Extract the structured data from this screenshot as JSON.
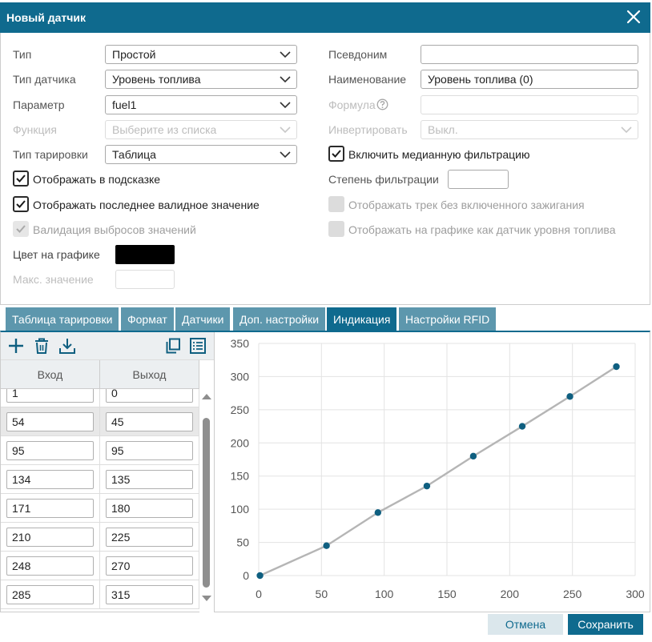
{
  "dialog": {
    "title": "Новый датчик"
  },
  "form": {
    "type": {
      "label": "Тип",
      "value": "Простой"
    },
    "sensor_type": {
      "label": "Тип датчика",
      "value": "Уровень топлива"
    },
    "parameter": {
      "label": "Параметр",
      "value": "fuel1"
    },
    "function": {
      "label": "Функция",
      "placeholder": "Выберите из списка"
    },
    "calibration_type": {
      "label": "Тип тарировки",
      "value": "Таблица"
    },
    "alias": {
      "label": "Псевдоним",
      "value": ""
    },
    "name": {
      "label": "Наименование",
      "value": "Уровень топлива (0)"
    },
    "formula": {
      "label": "Формула",
      "value": ""
    },
    "invert": {
      "label": "Инвертировать",
      "value": "Выкл."
    },
    "median_filter": {
      "label": "Включить медианную фильтрацию",
      "checked": true
    },
    "filter_degree": {
      "label": "Степень фильтрации",
      "value": ""
    },
    "show_tooltip": {
      "label": "Отображать в подсказке",
      "checked": true
    },
    "show_last_valid": {
      "label": "Отображать последнее валидное значение",
      "checked": true
    },
    "validate_outliers": {
      "label": "Валидация выбросов значений",
      "checked": true
    },
    "track_no_ignition": {
      "label": "Отображать трек без включенного зажигания",
      "checked": false
    },
    "chart_as_fuel": {
      "label": "Отображать на графике как датчик уровня топлива",
      "checked": false
    },
    "chart_color": {
      "label": "Цвет на графике",
      "value": "#000000"
    },
    "max_value": {
      "label": "Макс. значение",
      "value": ""
    }
  },
  "tabs": [
    {
      "label": "Таблица тарировки",
      "active": false
    },
    {
      "label": "Формат",
      "active": false
    },
    {
      "label": "Датчики",
      "active": false
    },
    {
      "label": "Доп. настройки",
      "active": false
    },
    {
      "label": "Индикация",
      "active": true
    },
    {
      "label": "Настройки RFID",
      "active": false
    }
  ],
  "table": {
    "headers": {
      "input": "Вход",
      "output": "Выход"
    },
    "rows": [
      {
        "in": "1",
        "out": "0"
      },
      {
        "in": "54",
        "out": "45"
      },
      {
        "in": "95",
        "out": "95"
      },
      {
        "in": "134",
        "out": "135"
      },
      {
        "in": "171",
        "out": "180"
      },
      {
        "in": "210",
        "out": "225"
      },
      {
        "in": "248",
        "out": "270"
      },
      {
        "in": "285",
        "out": "315"
      }
    ]
  },
  "chart_data": {
    "type": "line",
    "x": [
      1,
      54,
      95,
      134,
      171,
      210,
      248,
      285
    ],
    "y": [
      0,
      45,
      95,
      135,
      180,
      225,
      270,
      315
    ],
    "xlim": [
      0,
      300
    ],
    "ylim": [
      0,
      350
    ],
    "xticks": [
      "0",
      "50",
      "100",
      "150",
      "200",
      "250",
      "300"
    ],
    "yticks": [
      "0",
      "50",
      "100",
      "150",
      "200",
      "250",
      "300",
      "350"
    ],
    "grid": true,
    "line_color": "#b5b5b5",
    "point_color": "#0f5f80"
  },
  "footer": {
    "cancel_label": "Отмена",
    "save_label": "Сохранить"
  },
  "colors": {
    "accent": "#0f6a8e",
    "tab_inactive": "#5d97ad"
  }
}
